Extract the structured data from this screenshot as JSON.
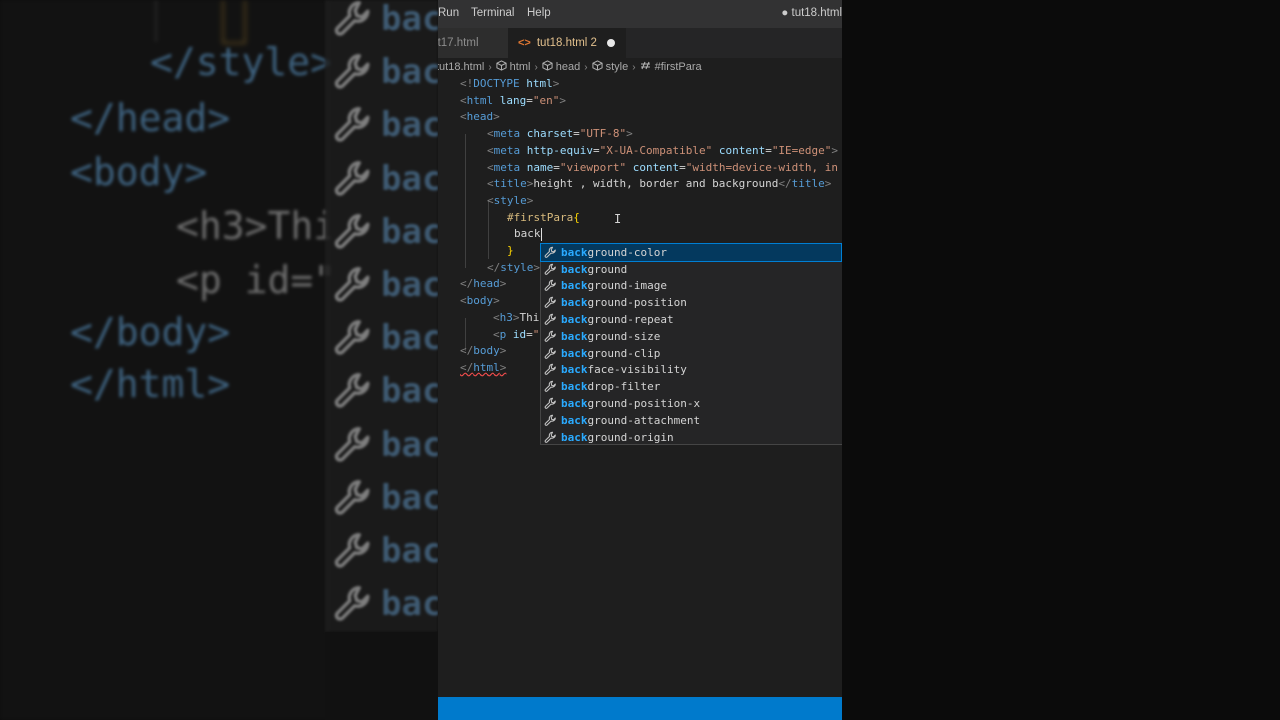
{
  "menubar": {
    "items": [
      "Run",
      "Terminal",
      "Help"
    ],
    "window_title": "● tut18.html"
  },
  "tabs": [
    {
      "label": "tut17.html",
      "active": false
    },
    {
      "label": "tut18.html 2",
      "active": true,
      "modified": true
    }
  ],
  "breadcrumb": [
    "tut18.html",
    "html",
    "head",
    "style",
    "#firstPara"
  ],
  "code_lines": [
    "<!DOCTYPE html>",
    "<html lang=\"en\">",
    "<head>",
    "<meta charset=\"UTF-8\">",
    "<meta http-equiv=\"X-UA-Compatible\" content=\"IE=edge\">",
    "<meta name=\"viewport\" content=\"width=device-width, in",
    "<title>height , width, border and background</title>",
    "<style>",
    "#firstPara{",
    "back",
    "}",
    "</style>",
    "</head>",
    "<body>",
    "<h3>Thi",
    "<p id=\"",
    "</body>",
    "</html>"
  ],
  "suggestions": {
    "typed_prefix": "back",
    "items": [
      {
        "match": "back",
        "rest": "ground-color",
        "selected": true
      },
      {
        "match": "back",
        "rest": "ground",
        "selected": false
      },
      {
        "match": "back",
        "rest": "ground-image",
        "selected": false
      },
      {
        "match": "back",
        "rest": "ground-position",
        "selected": false
      },
      {
        "match": "back",
        "rest": "ground-repeat",
        "selected": false
      },
      {
        "match": "back",
        "rest": "ground-size",
        "selected": false
      },
      {
        "match": "back",
        "rest": "ground-clip",
        "selected": false
      },
      {
        "match": "back",
        "rest": "face-visibility",
        "selected": false
      },
      {
        "match": "back",
        "rest": "drop-filter",
        "selected": false
      },
      {
        "match": "back",
        "rest": "ground-position-x",
        "selected": false
      },
      {
        "match": "back",
        "rest": "ground-attachment",
        "selected": false
      },
      {
        "match": "back",
        "rest": "ground-origin",
        "selected": false
      }
    ],
    "item_icon": "wrench-icon"
  },
  "background_zoom": {
    "lines": [
      "</style>",
      "</head>",
      "<body>",
      "<h3>Thi",
      "<p id=\"",
      "</body>",
      "</html>"
    ],
    "repeated_text": "bac"
  },
  "colors": {
    "accent": "#007acc",
    "tag": "#569cd6",
    "attribute": "#9cdcfe",
    "string": "#ce9178",
    "selector": "#d7ba7d",
    "match_highlight": "#2aaaff",
    "selection_bg": "#04395e"
  }
}
